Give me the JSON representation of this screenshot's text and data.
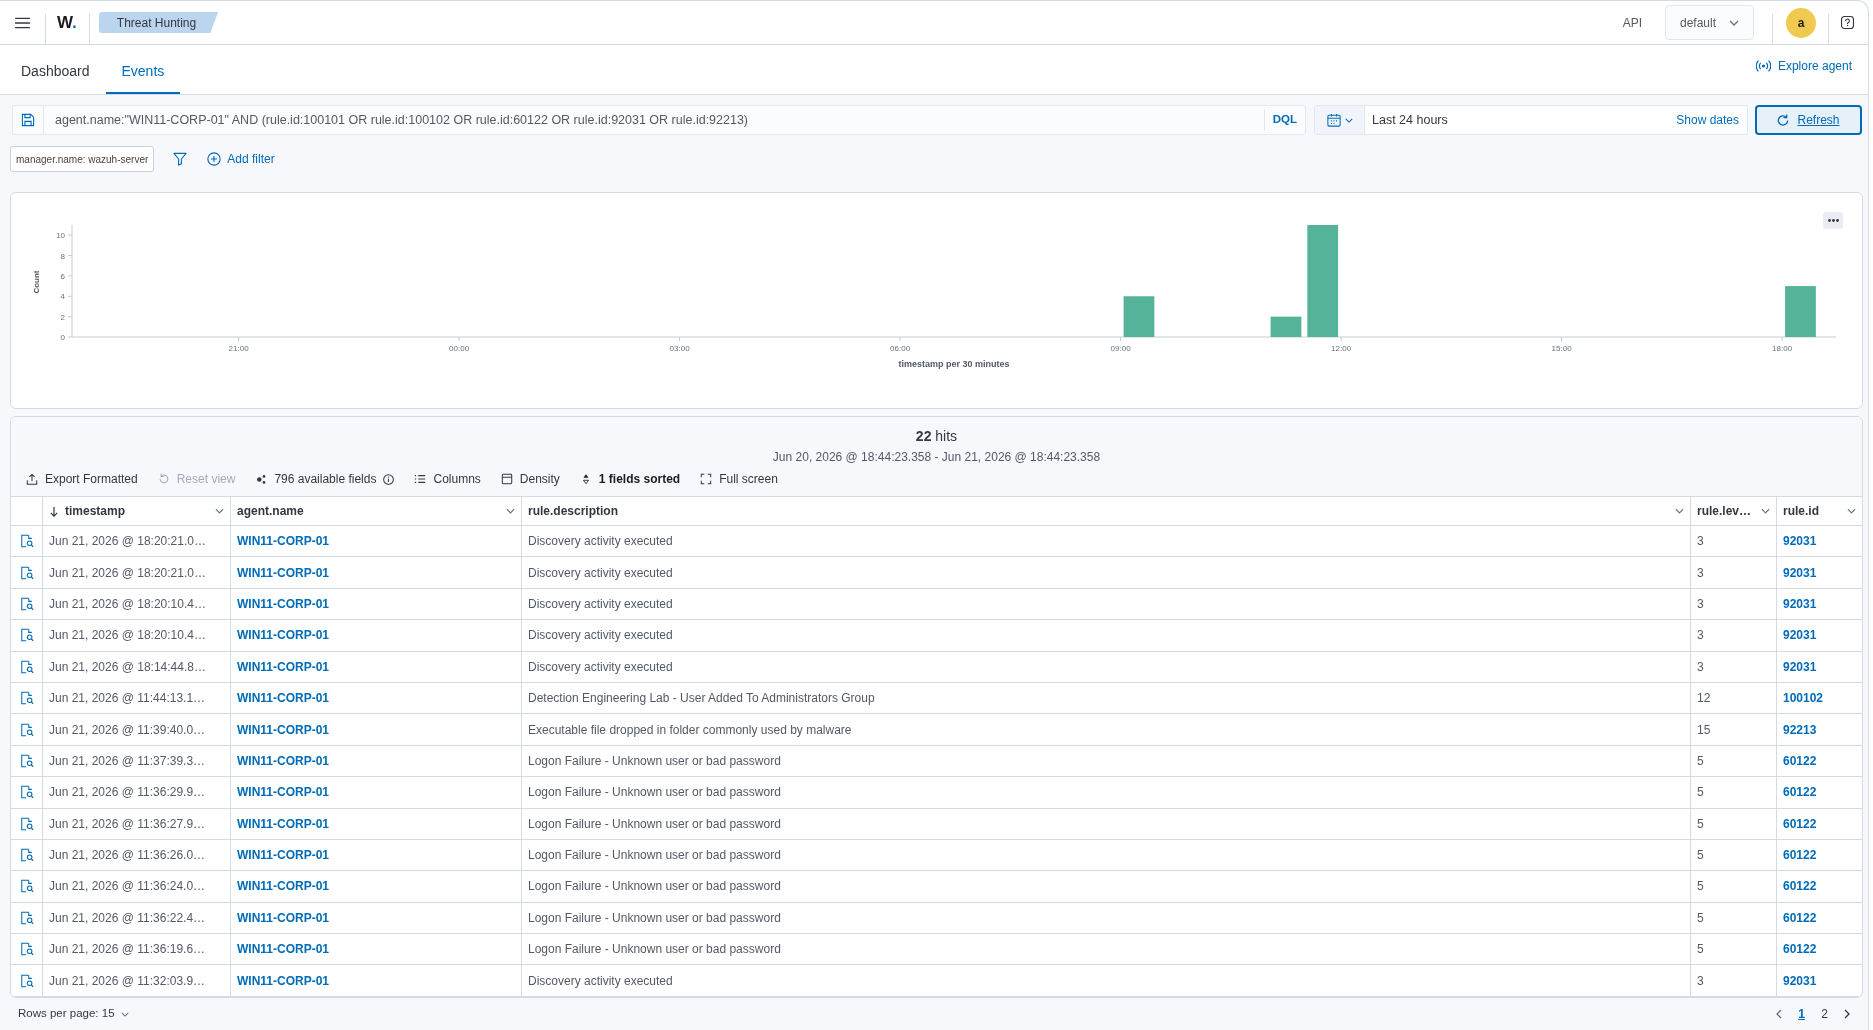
{
  "header": {
    "brand": {
      "letter": "W",
      "mark": "."
    },
    "breadcrumb": "Threat Hunting",
    "api": "API",
    "space": "default",
    "avatar": "a"
  },
  "tabs": [
    {
      "label": "Dashboard",
      "selected": false
    },
    {
      "label": "Events",
      "selected": true
    }
  ],
  "explore_agent": "Explore agent",
  "query_bar": {
    "query": "agent.name:\"WIN11-CORP-01\" AND (rule.id:100101 OR rule.id:100102 OR rule.id:60122 OR rule.id:92031 OR rule.id:92213)",
    "language": "DQL",
    "time_range": "Last 24 hours",
    "show_dates": "Show dates",
    "refresh": "Refresh"
  },
  "filters": [
    {
      "label": "manager.name: wazuh-server"
    }
  ],
  "add_filter": "Add filter",
  "histogram": {
    "chart_data": [
      {
        "type": "bar",
        "xlabel": "timestamp per 30 minutes",
        "ylabel": "Count",
        "x": [
          "2026-06-21T09:15",
          "2026-06-21T11:15",
          "2026-06-21T11:45",
          "2026-06-21T18:15"
        ],
        "values": [
          4,
          2,
          11,
          5
        ],
        "color": "#54b399",
        "xlim": [
          "2026-06-20T18:44",
          "2026-06-21T18:44"
        ],
        "ylim": [
          0,
          11
        ],
        "yticks": [
          0,
          2,
          4,
          6,
          8,
          10
        ],
        "xticks": [
          {
            "value": "2026-06-20T21:00",
            "label": "21:00"
          },
          {
            "value": "2026-06-21T00:00",
            "label": "00:00"
          },
          {
            "value": "2026-06-21T03:00",
            "label": "03:00"
          },
          {
            "value": "2026-06-21T06:00",
            "label": "06:00"
          },
          {
            "value": "2026-06-21T09:00",
            "label": "09:00"
          },
          {
            "value": "2026-06-21T12:00",
            "label": "12:00"
          },
          {
            "value": "2026-06-21T15:00",
            "label": "15:00"
          },
          {
            "value": "2026-06-21T18:00",
            "label": "18:00"
          }
        ]
      }
    ]
  },
  "results": {
    "hits": "**22** hits",
    "range": "Jun 20, 2026 @ 18:44:23.358 - Jun 21, 2026 @ 18:44:23.358",
    "toolbar": [
      {
        "kind": "export",
        "label": "Export Formatted",
        "disabled": false,
        "active": false
      },
      {
        "kind": "reset",
        "label": "Reset view",
        "disabled": true,
        "active": false
      },
      {
        "kind": "fields",
        "label": "796 available fields",
        "disabled": false,
        "active": false
      },
      {
        "kind": "columns",
        "label": "Columns",
        "disabled": false,
        "active": false
      },
      {
        "kind": "density",
        "label": "Density",
        "disabled": false,
        "active": false
      },
      {
        "kind": "sort",
        "label": "1 fields sorted",
        "disabled": false,
        "active": true
      },
      {
        "kind": "fullscreen",
        "label": "Full screen",
        "disabled": false,
        "active": false
      }
    ],
    "table": {
      "columns": [
        {
          "label": "timestamp",
          "kind": "text",
          "sorted": true
        },
        {
          "label": "agent.name",
          "kind": "link",
          "sorted": false
        },
        {
          "label": "rule.description",
          "kind": "text",
          "sorted": false
        },
        {
          "label": "rule.lev…",
          "kind": "text",
          "sorted": false
        },
        {
          "label": "rule.id",
          "kind": "link",
          "sorted": false
        }
      ],
      "rows": [
        [
          "Jun 21, 2026 @ 18:20:21.0…",
          "WIN11-CORP-01",
          "Discovery activity executed",
          "3",
          "92031"
        ],
        [
          "Jun 21, 2026 @ 18:20:21.0…",
          "WIN11-CORP-01",
          "Discovery activity executed",
          "3",
          "92031"
        ],
        [
          "Jun 21, 2026 @ 18:20:10.4…",
          "WIN11-CORP-01",
          "Discovery activity executed",
          "3",
          "92031"
        ],
        [
          "Jun 21, 2026 @ 18:20:10.4…",
          "WIN11-CORP-01",
          "Discovery activity executed",
          "3",
          "92031"
        ],
        [
          "Jun 21, 2026 @ 18:14:44.8…",
          "WIN11-CORP-01",
          "Discovery activity executed",
          "3",
          "92031"
        ],
        [
          "Jun 21, 2026 @ 11:44:13.1…",
          "WIN11-CORP-01",
          "Detection Engineering Lab - User Added To Administrators Group",
          "12",
          "100102"
        ],
        [
          "Jun 21, 2026 @ 11:39:40.0…",
          "WIN11-CORP-01",
          "Executable file dropped in folder commonly used by malware",
          "15",
          "92213"
        ],
        [
          "Jun 21, 2026 @ 11:37:39.3…",
          "WIN11-CORP-01",
          "Logon Failure - Unknown user or bad password",
          "5",
          "60122"
        ],
        [
          "Jun 21, 2026 @ 11:36:29.9…",
          "WIN11-CORP-01",
          "Logon Failure - Unknown user or bad password",
          "5",
          "60122"
        ],
        [
          "Jun 21, 2026 @ 11:36:27.9…",
          "WIN11-CORP-01",
          "Logon Failure - Unknown user or bad password",
          "5",
          "60122"
        ],
        [
          "Jun 21, 2026 @ 11:36:26.0…",
          "WIN11-CORP-01",
          "Logon Failure - Unknown user or bad password",
          "5",
          "60122"
        ],
        [
          "Jun 21, 2026 @ 11:36:24.0…",
          "WIN11-CORP-01",
          "Logon Failure - Unknown user or bad password",
          "5",
          "60122"
        ],
        [
          "Jun 21, 2026 @ 11:36:22.4…",
          "WIN11-CORP-01",
          "Logon Failure - Unknown user or bad password",
          "5",
          "60122"
        ],
        [
          "Jun 21, 2026 @ 11:36:19.6…",
          "WIN11-CORP-01",
          "Logon Failure - Unknown user or bad password",
          "5",
          "60122"
        ],
        [
          "Jun 21, 2026 @ 11:32:03.9…",
          "WIN11-CORP-01",
          "Discovery activity executed",
          "3",
          "92031"
        ]
      ]
    },
    "pagination": {
      "rows_per_page": "Rows per page: 15",
      "pages": [
        {
          "label": "1",
          "selected": true
        },
        {
          "label": "2",
          "selected": false
        }
      ]
    }
  }
}
